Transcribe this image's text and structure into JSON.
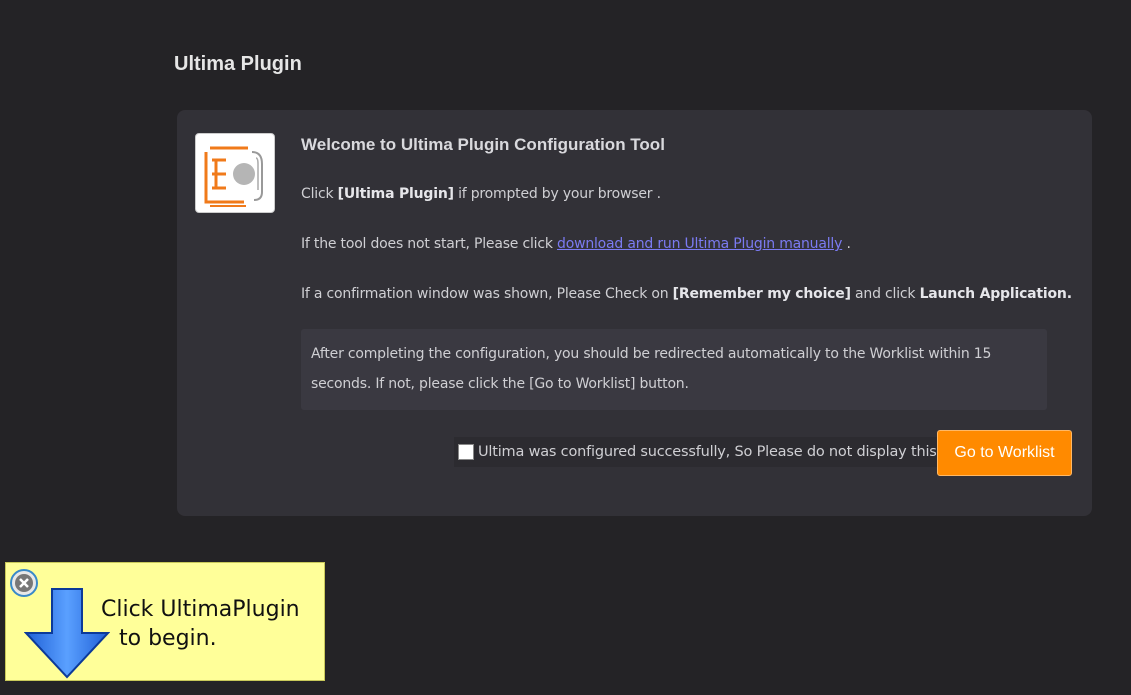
{
  "page": {
    "title": "Ultima Plugin"
  },
  "card": {
    "welcome": "Welcome to Ultima Plugin Configuration Tool",
    "line1": {
      "pre": "Click ",
      "bold": "[Ultima Plugin]",
      "post": " if prompted by your browser ."
    },
    "line2": {
      "pre": "If the tool does not start, Please click ",
      "link": "download and run Ultima Plugin manually",
      "post": " ."
    },
    "line3": {
      "pre": "If a confirmation window was shown, Please Check on ",
      "bold1": "[Remember my choice]",
      "mid": " and click ",
      "bold2": "Launch Application."
    },
    "notice": "After completing the configuration, you should be redirected automatically to the Worklist within 15 seconds. If not, please click the [Go to Worklist] button.",
    "checkbox_label": "Ultima was configured successfully, So Please do not display this page next time.",
    "checkbox_checked": false,
    "button_label": "Go to Worklist"
  },
  "popup": {
    "line1": "Click UltimaPlugin",
    "line2": "to begin.",
    "icons": {
      "close": "close-icon",
      "arrow": "arrow-down-icon"
    }
  },
  "colors": {
    "background": "#242326",
    "card": "#323137",
    "accent": "#ff8a00",
    "link": "#7b7bf2",
    "popup": "#ffff99"
  }
}
